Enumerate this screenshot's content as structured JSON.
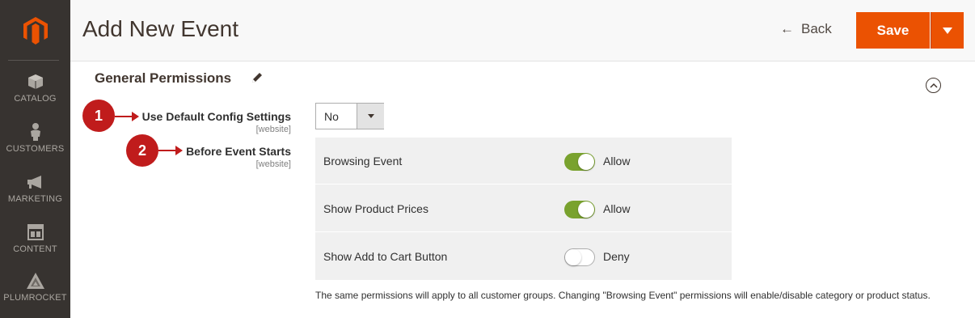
{
  "sidebar": {
    "logo": "magento-logo",
    "items": [
      {
        "label": "CATALOG",
        "icon": "cube-icon"
      },
      {
        "label": "CUSTOMERS",
        "icon": "person-icon"
      },
      {
        "label": "MARKETING",
        "icon": "megaphone-icon"
      },
      {
        "label": "CONTENT",
        "icon": "layout-icon"
      },
      {
        "label": "PLUMROCKET",
        "icon": "plumrocket-icon"
      }
    ]
  },
  "header": {
    "title": "Add New Event",
    "back_label": "Back",
    "save_label": "Save"
  },
  "section": {
    "title": "General Permissions"
  },
  "callouts": [
    "1",
    "2"
  ],
  "fields": {
    "use_default": {
      "label": "Use Default Config Settings",
      "scope": "[website]",
      "value": "No"
    },
    "before_event": {
      "label": "Before Event Starts",
      "scope": "[website]"
    }
  },
  "permissions": [
    {
      "label": "Browsing Event",
      "state": "Allow",
      "on": true
    },
    {
      "label": "Show Product Prices",
      "state": "Allow",
      "on": true
    },
    {
      "label": "Show Add to Cart Button",
      "state": "Deny",
      "on": false
    }
  ],
  "note": "The same permissions will apply to all customer groups. Changing \"Browsing Event\" permissions will enable/disable category or product status.",
  "colors": {
    "sidebar_bg": "#373330",
    "accent": "#eb5202",
    "toggle_on": "#79a22e",
    "callout": "#c01c1c"
  }
}
